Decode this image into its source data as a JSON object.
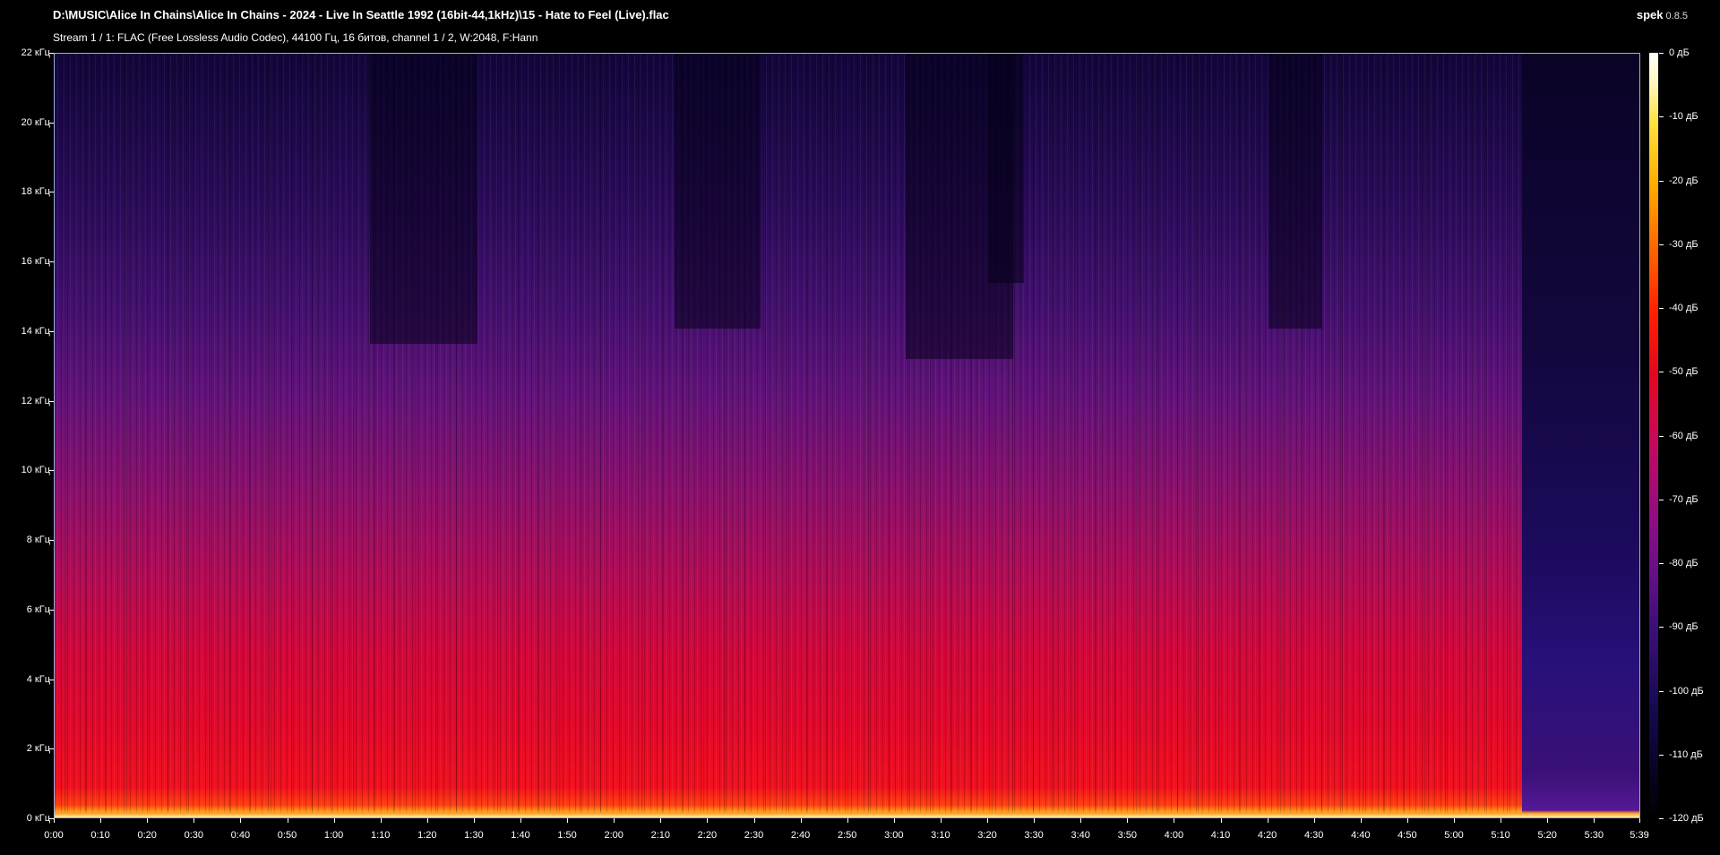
{
  "header": {
    "title": "D:\\MUSIC\\Alice In Chains\\Alice In Chains - 2024 - Live In Seattle 1992 (16bit-44,1kHz)\\15 - Hate to Feel (Live).flac",
    "stream_info": "Stream 1 / 1: FLAC (Free Lossless Audio Codec), 44100 Гц, 16 битов, channel 1 / 2, W:2048, F:Hann",
    "app_name": "spek",
    "app_version": "0.8.5"
  },
  "freq_axis": [
    "22 кГц",
    "20 кГц",
    "18 кГц",
    "16 кГц",
    "14 кГц",
    "12 кГц",
    "10 кГц",
    "8 кГц",
    "6 кГц",
    "4 кГц",
    "2 кГц",
    "0 кГц"
  ],
  "time_axis": [
    "0:00",
    "0:10",
    "0:20",
    "0:30",
    "0:40",
    "0:50",
    "1:00",
    "1:10",
    "1:20",
    "1:30",
    "1:40",
    "1:50",
    "2:00",
    "2:10",
    "2:20",
    "2:30",
    "2:40",
    "2:50",
    "3:00",
    "3:10",
    "3:20",
    "3:30",
    "3:40",
    "3:50",
    "4:00",
    "4:10",
    "4:20",
    "4:30",
    "4:40",
    "4:50",
    "5:00",
    "5:10",
    "5:20",
    "5:30",
    "5:39"
  ],
  "db_scale": [
    "0 дБ",
    "-10 дБ",
    "-20 дБ",
    "-30 дБ",
    "-40 дБ",
    "-50 дБ",
    "-60 дБ",
    "-70 дБ",
    "-80 дБ",
    "-90 дБ",
    "-100 дБ",
    "-110 дБ",
    "-120 дБ"
  ],
  "colors": {
    "background": "#000000",
    "low": "#12053a",
    "mid": "#e2082a",
    "high": "#fff2a0"
  }
}
